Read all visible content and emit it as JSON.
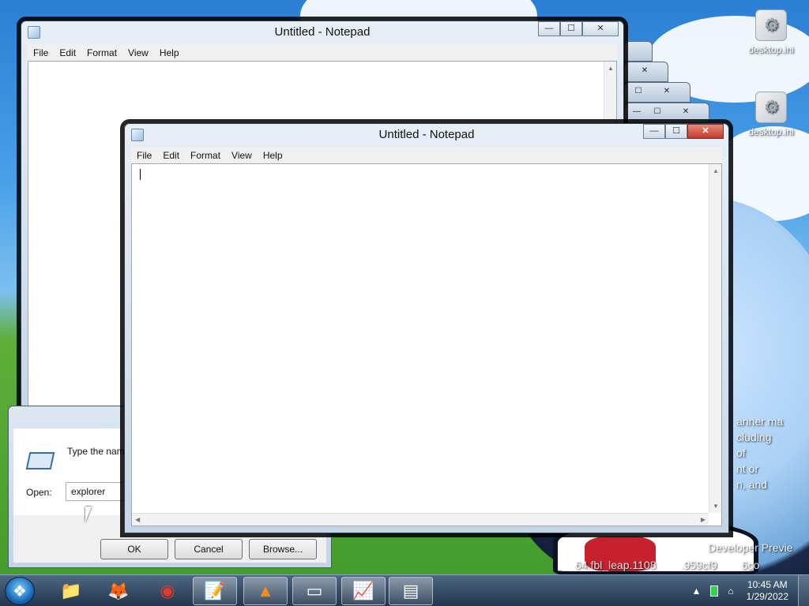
{
  "desktop": {
    "icons": [
      {
        "label": "desktop.ini"
      },
      {
        "label": "desktop.ini"
      }
    ],
    "watermark_lines": [
      "anner ma",
      "cluding",
      "of",
      "nt or",
      "n, and"
    ],
    "build_line1": "Developer Previe",
    "build_line2": "64.fbl_leap.1108        .959cf9        6co"
  },
  "notepad_back": {
    "title": "Untitled - Notepad",
    "menu": [
      "File",
      "Edit",
      "Format",
      "View",
      "Help"
    ],
    "caption": {
      "minimize": "—",
      "maximize": "☐",
      "close": "✕"
    }
  },
  "notepad_front": {
    "title": "Untitled - Notepad",
    "menu": [
      "File",
      "Edit",
      "Format",
      "View",
      "Help"
    ],
    "caption": {
      "minimize": "—",
      "maximize": "☐",
      "close": "✕"
    },
    "content": ""
  },
  "run_dialog": {
    "description": "Type the nam resource, and",
    "open_label": "Open:",
    "input_value": "explorer",
    "buttons": {
      "ok": "OK",
      "cancel": "Cancel",
      "browse": "Browse..."
    }
  },
  "taskbar": {
    "items": [
      {
        "name": "file-explorer",
        "icon": "📁"
      },
      {
        "name": "firefox",
        "icon": "🦊"
      },
      {
        "name": "chrome",
        "icon": "◉"
      },
      {
        "name": "notepad",
        "icon": "📝"
      },
      {
        "name": "vlc",
        "icon": "▲"
      },
      {
        "name": "run",
        "icon": "▭"
      },
      {
        "name": "task-manager",
        "icon": "📈"
      },
      {
        "name": "window-app",
        "icon": "▤"
      }
    ],
    "tray": {
      "expand": "▲",
      "network": "⌂",
      "time": "10:45 AM",
      "date": "1/29/2022"
    }
  }
}
